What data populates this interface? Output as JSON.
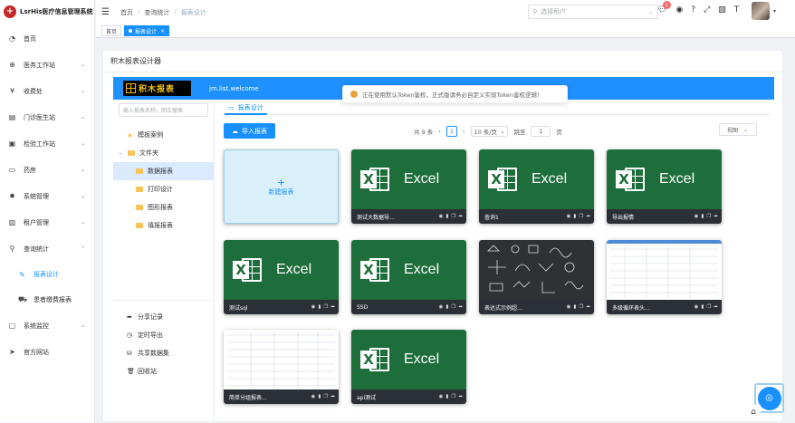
{
  "app": {
    "title": "LsrHis医疗信息管理系统"
  },
  "sidebar": {
    "items": [
      {
        "label": "首页",
        "icon": "dashboard-icon"
      },
      {
        "label": "医务工作站",
        "icon": "plus-icon",
        "arrow": "⌄"
      },
      {
        "label": "收费处",
        "icon": "yen-icon",
        "arrow": "⌄"
      },
      {
        "label": "门诊医生站",
        "icon": "clipboard-icon",
        "arrow": "⌄"
      },
      {
        "label": "检验工作站",
        "icon": "flask-icon",
        "arrow": "⌄"
      },
      {
        "label": "药房",
        "icon": "pill-icon",
        "arrow": "⌄"
      },
      {
        "label": "系统管理",
        "icon": "gear-icon",
        "arrow": "⌄"
      },
      {
        "label": "租户管理",
        "icon": "chart-icon",
        "arrow": "⌄"
      },
      {
        "label": "查询统计",
        "icon": "search-icon",
        "arrow": "⌃"
      },
      {
        "label": "报表设计",
        "icon": "edit-icon",
        "sub": true,
        "active": true
      },
      {
        "label": "患者缴费报表",
        "icon": "car-icon",
        "sub": true
      },
      {
        "label": "系统监控",
        "icon": "monitor-icon",
        "arrow": "⌄"
      },
      {
        "label": "官方网站",
        "icon": "send-icon"
      }
    ]
  },
  "header": {
    "breadcrumb": [
      "首页",
      "查询统计",
      "报表设计"
    ],
    "tenant_placeholder": "选择租户",
    "notification_count": "1"
  },
  "tags": [
    {
      "label": "首页"
    },
    {
      "label": "报表设计"
    }
  ],
  "card": {
    "title": "积木报表设计器"
  },
  "designer": {
    "logo_text": "积木报表",
    "welcome": "jm.list.welcome",
    "toast": "正在使用默认Token鉴权，正式版请务必自定义实现Token鉴权逻辑！",
    "search_placeholder": "输入报表名称，回车搜索",
    "tree": {
      "template": "模板案例",
      "folder": "文件夹",
      "children": [
        "数据报表",
        "打印设计",
        "图形报表",
        "填报报表"
      ]
    },
    "footer_links": [
      {
        "label": "分享记录",
        "icon": "share-icon"
      },
      {
        "label": "定时导出",
        "icon": "clock-icon"
      },
      {
        "label": "共享数据集",
        "icon": "dataset-icon"
      },
      {
        "label": "回收站",
        "icon": "trash-icon"
      }
    ],
    "tab": "报表设计",
    "import_btn": "导入报表",
    "pager": {
      "total": "共 9 条",
      "page": "1",
      "per_page": "10 条/页",
      "goto": "跳至",
      "goto_value": "1",
      "page_suffix": "页"
    },
    "view": "视图",
    "new_report": "新建报表",
    "reports": [
      {
        "name": "测试大数据导…",
        "thumb": "excel"
      },
      {
        "name": "查询1",
        "thumb": "excel"
      },
      {
        "name": "导出报情",
        "thumb": "excel"
      },
      {
        "name": "测试sql",
        "thumb": "excel"
      },
      {
        "name": "SSD",
        "thumb": "excel"
      },
      {
        "name": "表达式示例超…",
        "thumb": "chalkboard"
      },
      {
        "name": "多级循环表头…",
        "thumb": "spreadsheet"
      },
      {
        "name": "简单分组报表…",
        "thumb": "spreadsheet"
      },
      {
        "name": "api测试",
        "thumb": "excel"
      }
    ],
    "excel_word": "Excel"
  },
  "colors": {
    "accent": "#1890ff",
    "excel_green": "#1d6e3a",
    "banner": "#1e90ff",
    "warning": "#e6a23c"
  }
}
